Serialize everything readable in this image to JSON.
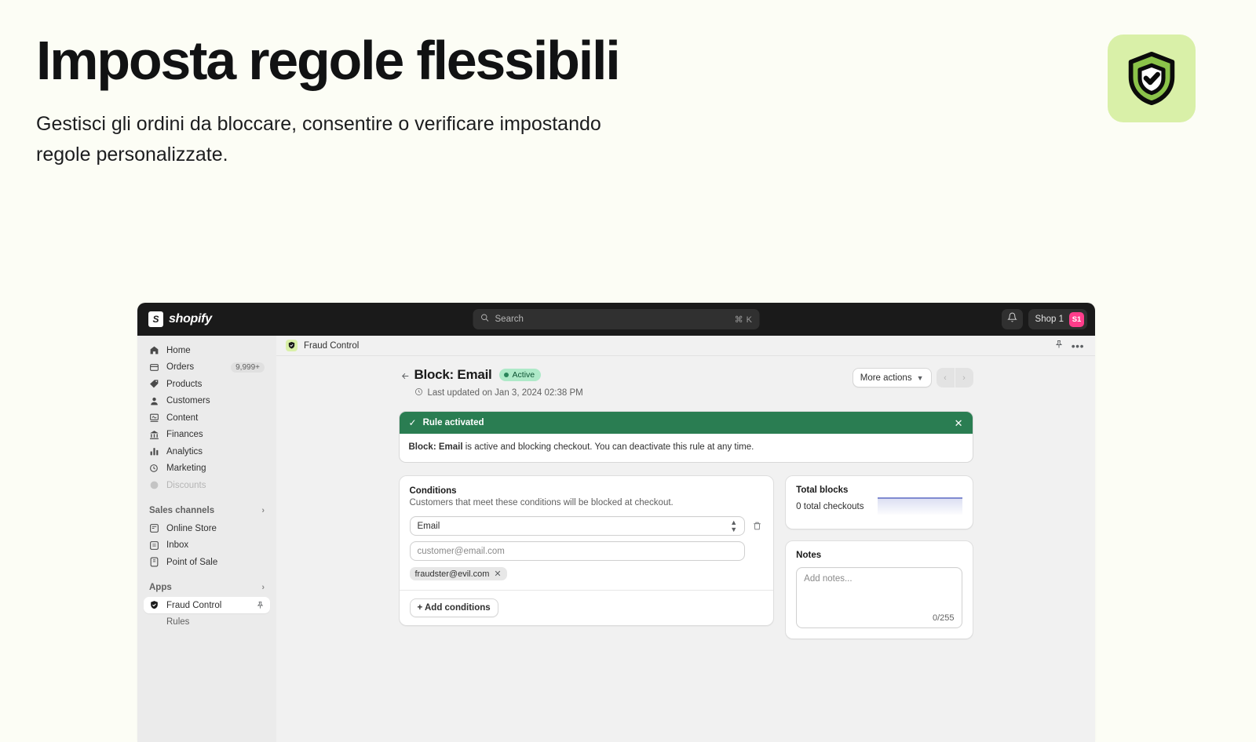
{
  "hero": {
    "title": "Imposta regole flessibili",
    "subtitle": "Gestisci gli ordini da bloccare, consentire o verificare impostando regole personalizzate.",
    "app_icon": "shield-check-icon",
    "badge_bg": "#d9f0a8"
  },
  "topbar": {
    "brand_mark": "S",
    "brand_name": "shopify",
    "search": {
      "placeholder": "Search",
      "shortcut": "⌘ K",
      "icon": "search-icon"
    },
    "notifications_icon": "bell-icon",
    "store_name": "Shop 1",
    "avatar_initials": "S1",
    "avatar_color": "#ff3d8b"
  },
  "sidebar": {
    "items": [
      {
        "label": "Home",
        "icon": "home-icon"
      },
      {
        "label": "Orders",
        "icon": "orders-icon",
        "badge": "9,999+"
      },
      {
        "label": "Products",
        "icon": "products-icon"
      },
      {
        "label": "Customers",
        "icon": "customers-icon"
      },
      {
        "label": "Content",
        "icon": "content-icon"
      },
      {
        "label": "Finances",
        "icon": "finances-icon"
      },
      {
        "label": "Analytics",
        "icon": "analytics-icon"
      },
      {
        "label": "Marketing",
        "icon": "marketing-icon"
      },
      {
        "label": "Discounts",
        "icon": "discounts-icon"
      }
    ],
    "sales_channels": {
      "title": "Sales channels",
      "items": [
        {
          "label": "Online Store",
          "icon": "store-icon"
        },
        {
          "label": "Inbox",
          "icon": "inbox-icon"
        },
        {
          "label": "Point of Sale",
          "icon": "pos-icon"
        }
      ]
    },
    "apps": {
      "title": "Apps",
      "items": [
        {
          "label": "Fraud Control",
          "icon": "shield-check-icon",
          "active": true,
          "pin": "pin-icon"
        }
      ],
      "sub_items": [
        {
          "label": "Rules"
        }
      ]
    }
  },
  "app_header": {
    "app_name": "Fraud Control",
    "app_icon": "shield-check-icon",
    "pin_icon": "pin-icon",
    "more_icon": "ellipsis-icon"
  },
  "page": {
    "back_icon": "arrow-left-icon",
    "title": "Block: Email",
    "status_badge": "Active",
    "status_color": "#aee9c8",
    "timestamp_icon": "clock-icon",
    "timestamp": "Last updated on Jan 3, 2024 02:38 PM",
    "more_actions": "More actions",
    "pager_prev": "‹",
    "pager_next": "›"
  },
  "banner": {
    "check_icon": "check-icon",
    "heading": "Rule activated",
    "close_icon": "close-icon",
    "body_bold": "Block: Email",
    "body_rest": " is active and blocking checkout. You can deactivate this rule at any time.",
    "accent": "#2a7d52"
  },
  "conditions_card": {
    "title": "Conditions",
    "description": "Customers that meet these conditions will be blocked at checkout.",
    "select_value": "Email",
    "select_icon": "chevron-updown-icon",
    "delete_icon": "trash-icon",
    "input_placeholder": "customer@email.com",
    "input_value": "",
    "chips": [
      {
        "label": "fraudster@evil.com",
        "remove_icon": "close-icon"
      }
    ],
    "add_button": "+ Add conditions"
  },
  "total_blocks_card": {
    "title": "Total blocks",
    "subtitle": "0 total checkouts",
    "chart_color": "#5c6ac4"
  },
  "notes_card": {
    "title": "Notes",
    "placeholder": "Add notes...",
    "value": "",
    "counter": "0/255"
  },
  "chart_data": {
    "type": "area",
    "title": "Total blocks",
    "x": [
      0,
      1,
      2,
      3,
      4,
      5,
      6
    ],
    "values": [
      0,
      0,
      0,
      0,
      0,
      0,
      0
    ],
    "ylabel": "",
    "xlabel": "",
    "ylim": [
      0,
      1
    ],
    "grid": false,
    "legend": "none"
  }
}
